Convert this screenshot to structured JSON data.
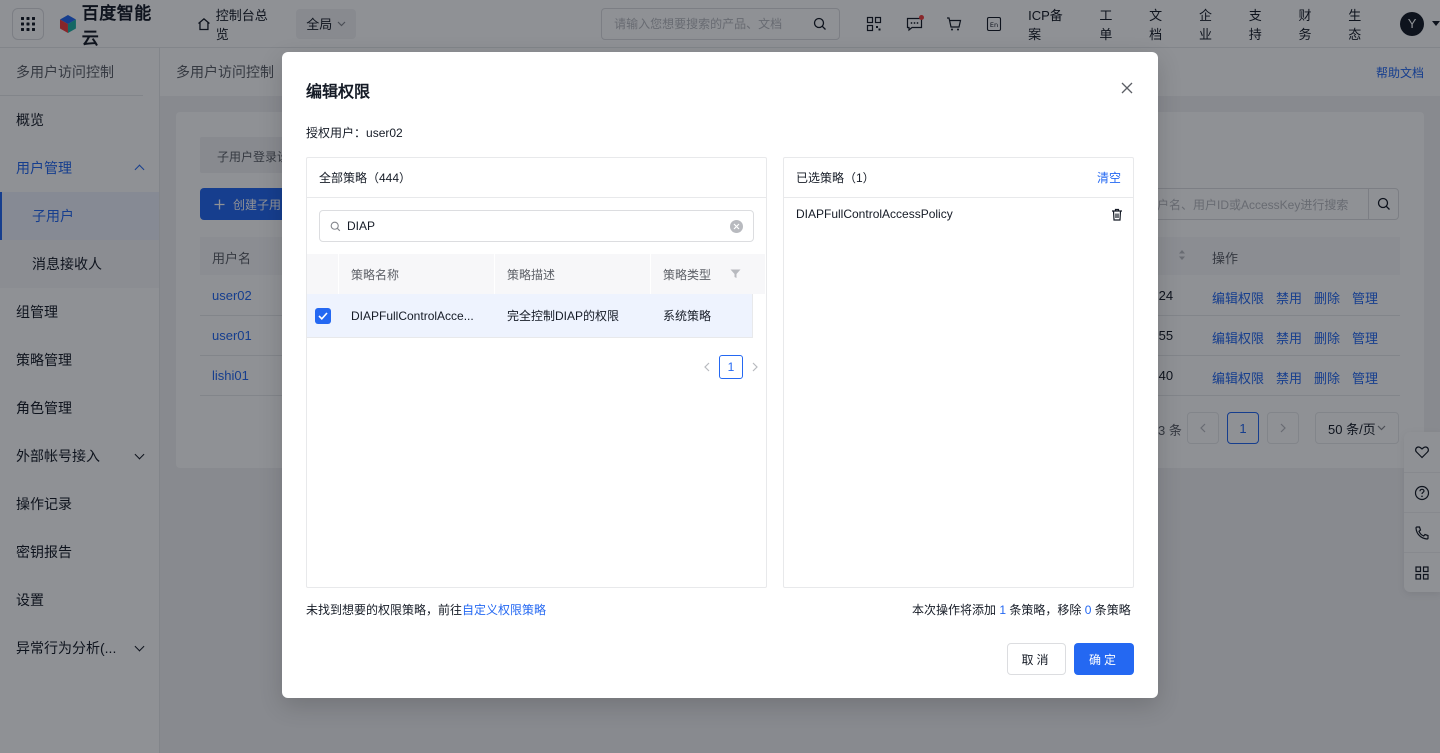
{
  "topbar": {
    "logo_text": "百度智能云",
    "home_label": "控制台总览",
    "scope_label": "全局",
    "search_placeholder": "请输入您想要搜索的产品、文档",
    "links": [
      "ICP备案",
      "工单",
      "文档",
      "企业",
      "支持",
      "财务",
      "生态"
    ],
    "avatar_letter": "Y",
    "icons": [
      "qrcode-icon",
      "message-icon",
      "cart-icon",
      "language-icon"
    ]
  },
  "sidebar": {
    "title": "多用户访问控制",
    "items": [
      {
        "label": "概览"
      },
      {
        "label": "用户管理",
        "expanded": true
      },
      {
        "label": "子用户",
        "sub": true,
        "selected": true
      },
      {
        "label": "消息接收人",
        "sub": true
      },
      {
        "label": "组管理"
      },
      {
        "label": "策略管理"
      },
      {
        "label": "角色管理"
      },
      {
        "label": "外部帐号接入"
      },
      {
        "label": "操作记录"
      },
      {
        "label": "密钥报告"
      },
      {
        "label": "设置"
      },
      {
        "label": "异常行为分析(..."
      }
    ]
  },
  "background": {
    "breadcrumb": "多用户访问控制",
    "help_link": "帮助文档",
    "tab_label": "子用户登录设",
    "create_button": "创建子用",
    "search_placeholder": "户名、用户ID或AccessKey进行搜索",
    "columns": {
      "user": "用户名",
      "ops": "操作"
    },
    "rows": [
      {
        "user": "user02",
        "time": ":24"
      },
      {
        "user": "user01",
        "time": ":55"
      },
      {
        "user": "lishi01",
        "time": ":40"
      }
    ],
    "row_ops": [
      "编辑权限",
      "禁用",
      "删除",
      "管理"
    ],
    "total_text": "3 条",
    "current_page": "1",
    "page_size": "50 条/页"
  },
  "modal": {
    "title": "编辑权限",
    "auth_user_label": "授权用户：",
    "auth_user": "user02",
    "left_panel": {
      "title": "全部策略（444）",
      "search_value": "DIAP",
      "columns": {
        "name": "策略名称",
        "desc": "策略描述",
        "type": "策略类型"
      },
      "rows": [
        {
          "name": "DIAPFullControlAcce...",
          "desc": "完全控制DIAP的权限",
          "type": "系统策略",
          "checked": true
        }
      ],
      "page": "1"
    },
    "right_panel": {
      "title": "已选策略（1）",
      "clear_label": "清空",
      "items": [
        "DIAPFullControlAccessPolicy"
      ]
    },
    "footer_left_text": "未找到想要的权限策略，前往",
    "footer_left_link": "自定义权限策略",
    "footer_right": {
      "prefix": "本次操作将添加",
      "add_count": "1",
      "middle": "条策略，移除",
      "remove_count": "0",
      "suffix": "条策略"
    },
    "cancel_label": "取消",
    "ok_label": "确定"
  },
  "colors": {
    "accent": "#2468f2",
    "text": "#151b26",
    "muted": "#5c5f66"
  }
}
